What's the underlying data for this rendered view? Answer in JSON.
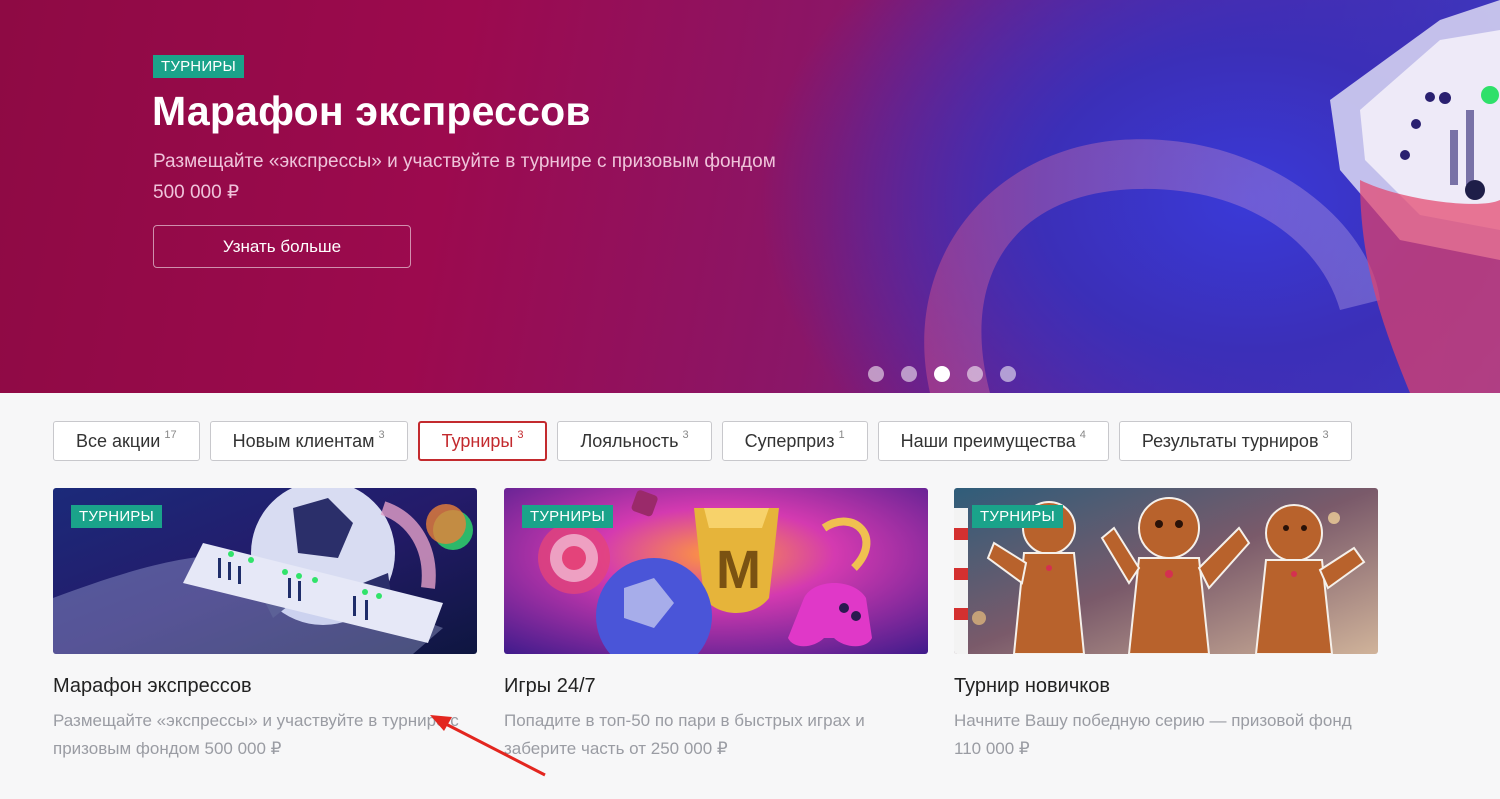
{
  "hero": {
    "badge": "ТУРНИРЫ",
    "title": "Марафон экспрессов",
    "subtitle_line1": "Размещайте «экспрессы» и участвуйте в турнире с призовым фондом",
    "subtitle_line2": "500 000 ₽",
    "button_label": "Узнать больше",
    "slides_total": 5,
    "active_slide": 3
  },
  "tabs": [
    {
      "label": "Все акции",
      "count": "17",
      "active": false
    },
    {
      "label": "Новым клиентам",
      "count": "3",
      "active": false
    },
    {
      "label": "Турниры",
      "count": "3",
      "active": true
    },
    {
      "label": "Лояльность",
      "count": "3",
      "active": false
    },
    {
      "label": "Суперприз",
      "count": "1",
      "active": false
    },
    {
      "label": "Наши преимущества",
      "count": "4",
      "active": false
    },
    {
      "label": "Результаты турниров",
      "count": "3",
      "active": false
    }
  ],
  "cards": [
    {
      "badge": "ТУРНИРЫ",
      "title": "Марафон экспрессов",
      "description": "Размещайте «экспрессы» и участвуйте в турнире с призовым фондом 500 000 ₽",
      "image": "football-ticket-image"
    },
    {
      "badge": "ТУРНИРЫ",
      "title": "Игры 24/7",
      "description": "Попадите в топ-50 по пари в быстрых играх и заберите часть от 250 000 ₽",
      "image": "trophy-games-image"
    },
    {
      "badge": "ТУРНИРЫ",
      "title": "Турнир новичков",
      "description": "Начните Вашу победную серию — призовой фонд 110 000 ₽",
      "image": "gingerbread-men-image"
    }
  ],
  "colors": {
    "accent": "#c32a2e",
    "badge": "#1aa38a",
    "hero_start": "#8e0a44",
    "hero_end": "#3540c8",
    "annotation_arrow": "#e3261f"
  }
}
